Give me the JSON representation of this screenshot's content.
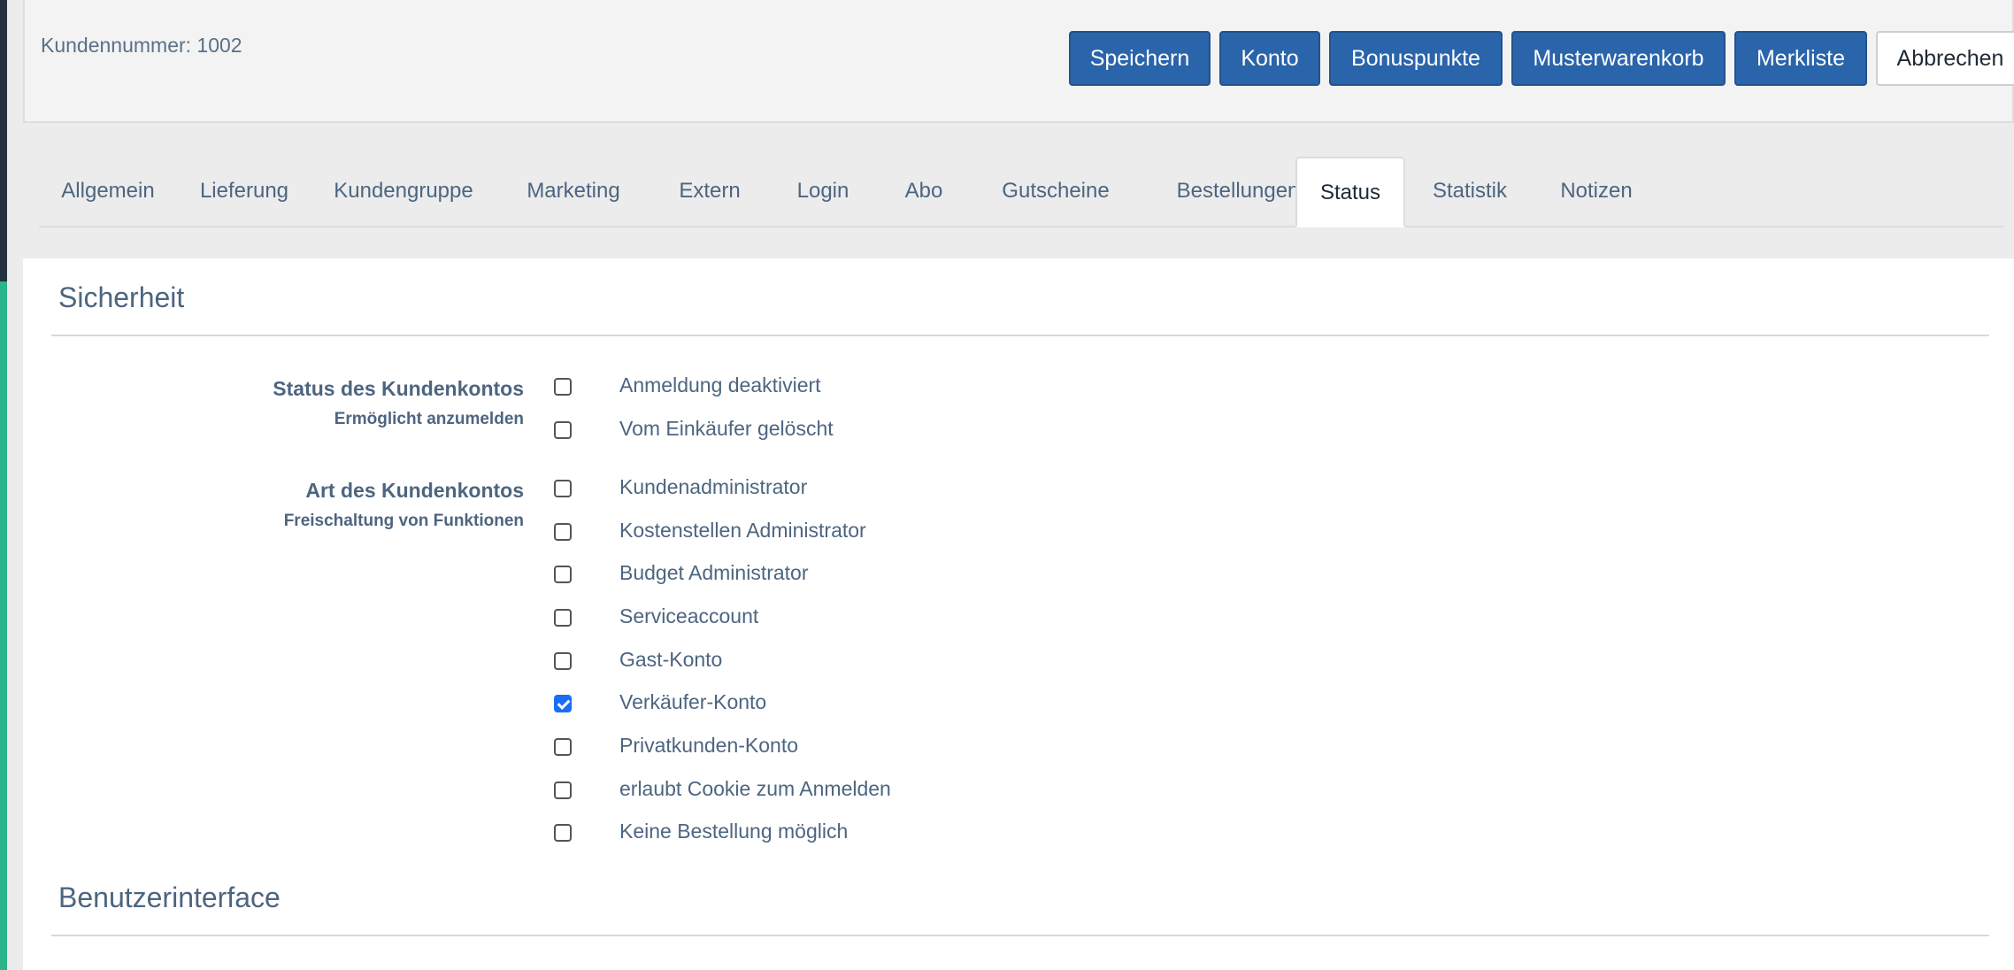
{
  "header": {
    "customer_number": "Kundennummer: 1002"
  },
  "toolbar": {
    "buttons": [
      {
        "label": "Speichern",
        "style": "primary"
      },
      {
        "label": "Konto",
        "style": "primary"
      },
      {
        "label": "Bonuspunkte",
        "style": "primary"
      },
      {
        "label": "Musterwarenkorb",
        "style": "primary"
      },
      {
        "label": "Merkliste",
        "style": "primary"
      },
      {
        "label": "Abbrechen",
        "style": "default"
      }
    ]
  },
  "tabs": [
    {
      "label": "Allgemein",
      "active": false
    },
    {
      "label": "Lieferung",
      "active": false
    },
    {
      "label": "Kundengruppe",
      "active": false
    },
    {
      "label": "Marketing",
      "active": false
    },
    {
      "label": "Extern",
      "active": false
    },
    {
      "label": "Login",
      "active": false
    },
    {
      "label": "Abo",
      "active": false
    },
    {
      "label": "Gutscheine",
      "active": false
    },
    {
      "label": "Bestellungen",
      "active": false
    },
    {
      "label": "Status",
      "active": true
    },
    {
      "label": "Statistik",
      "active": false
    },
    {
      "label": "Notizen",
      "active": false
    }
  ],
  "sections": {
    "security": {
      "title": "Sicherheit",
      "groups": [
        {
          "label": "Status des Kundenkontos",
          "sublabel": "Ermöglicht anzumelden",
          "options": [
            {
              "label": "Anmeldung deaktiviert",
              "checked": false
            },
            {
              "label": "Vom Einkäufer gelöscht",
              "checked": false
            }
          ]
        },
        {
          "label": "Art des Kundenkontos",
          "sublabel": "Freischaltung von Funktionen",
          "options": [
            {
              "label": "Kundenadministrator",
              "checked": false
            },
            {
              "label": "Kostenstellen Administrator",
              "checked": false
            },
            {
              "label": "Budget Administrator",
              "checked": false
            },
            {
              "label": "Serviceaccount",
              "checked": false
            },
            {
              "label": "Gast-Konto",
              "checked": false
            },
            {
              "label": "Verkäufer-Konto",
              "checked": true
            },
            {
              "label": "Privatkunden-Konto",
              "checked": false
            },
            {
              "label": "erlaubt Cookie zum Anmelden",
              "checked": false
            },
            {
              "label": "Keine Bestellung möglich",
              "checked": false
            }
          ]
        }
      ]
    },
    "ui": {
      "title": "Benutzerinterface"
    }
  },
  "colors": {
    "primary": "#2a64aa",
    "checkbox_checked": "#1a6ef5",
    "sidebar_dark": "#24303f",
    "sidebar_accent": "#2ab48a"
  }
}
